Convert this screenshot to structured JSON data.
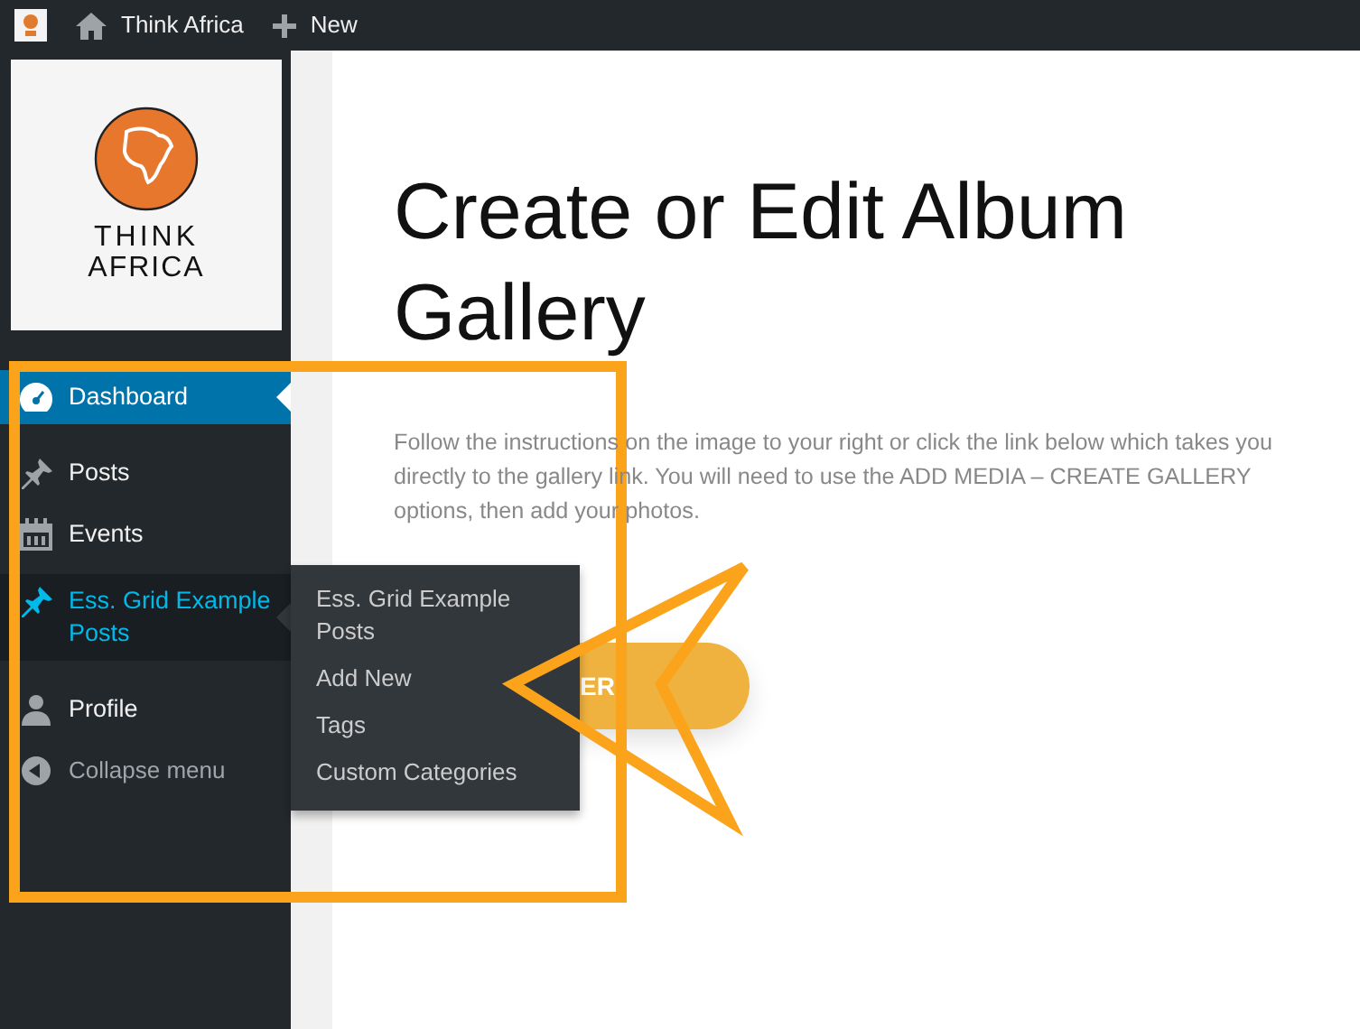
{
  "topbar": {
    "site_name": "Think Africa",
    "new_label": "New"
  },
  "logo": {
    "line_1": "THINK",
    "line_2": "AFRICA"
  },
  "menu": [
    {
      "kind": "item",
      "label": "Dashboard",
      "selected": true,
      "open": false
    },
    {
      "kind": "item",
      "label": "Posts",
      "selected": false,
      "open": false
    },
    {
      "kind": "item",
      "label": "Events",
      "selected": false,
      "open": false
    },
    {
      "kind": "item",
      "label": "Ess. Grid Example Posts",
      "selected": false,
      "open": true
    },
    {
      "kind": "item",
      "label": "Profile",
      "selected": false,
      "open": false
    },
    {
      "kind": "collapse",
      "label": "Collapse menu",
      "selected": false,
      "open": false
    }
  ],
  "flyout": {
    "items": [
      "Ess. Grid Example Posts",
      "Add New",
      "Tags",
      "Custom Categories"
    ]
  },
  "page": {
    "title": "Create or Edit Album Gallery",
    "text": "Follow the instructions on the image to your right or click the link below which takes you directly to the gallery link. You will need to use the ADD MEDIA – CREATE GALLERY options, then add your photos.",
    "button": "ER"
  }
}
